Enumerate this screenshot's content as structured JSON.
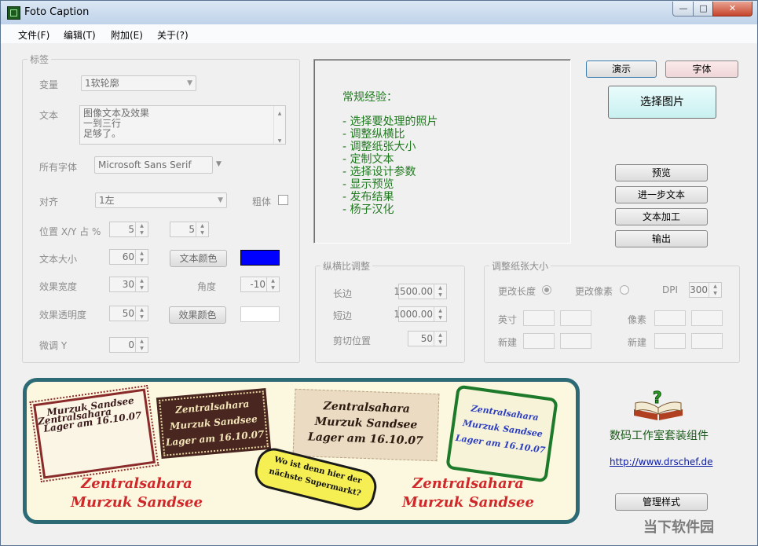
{
  "window": {
    "title": "Foto Caption"
  },
  "titlebar": {
    "min": "—",
    "max": "□",
    "close": "✕"
  },
  "menu": [
    "文件(F)",
    "编辑(T)",
    "附加(E)",
    "关于(?)"
  ],
  "label_group": {
    "title": "标签",
    "variant_label": "变量",
    "variant_value": "1软轮廓",
    "text_label": "文本",
    "text_lines": [
      "图像文本及效果",
      "一到三行",
      "足够了。"
    ],
    "font_label": "所有字体",
    "font_value": "Microsoft Sans Serif",
    "align_label": "对齐",
    "align_value": "1左",
    "bold_label": "粗体",
    "pos_label": "位置 X/Y 占 %",
    "pos_x": "5",
    "pos_y": "5",
    "size_label": "文本大小",
    "size_value": "60",
    "text_color_button": "文本颜色",
    "text_color": "#0000ff",
    "effect_width_label": "效果宽度",
    "effect_width_value": "30",
    "angle_label": "角度",
    "angle_value": "-10",
    "effect_opacity_label": "效果透明度",
    "effect_opacity_value": "50",
    "effect_color_button": "效果颜色",
    "effect_color": "#ffffff",
    "fine_y_label": "微调 Y",
    "fine_y_value": "0"
  },
  "preview": {
    "heading": "常规经验：",
    "steps": [
      "- 选择要处理的照片",
      "- 调整纵横比",
      "- 调整纸张大小",
      "- 定制文本",
      "- 选择设计参数",
      "- 显示预览",
      "- 发布结果",
      "- 杨子汉化"
    ]
  },
  "aspect_group": {
    "title": "纵横比调整",
    "long_label": "长边",
    "long_value": "1500.00",
    "short_label": "短边",
    "short_value": "1000.00",
    "crop_label": "剪切位置",
    "crop_value": "50"
  },
  "paper_group": {
    "title": "调整纸张大小",
    "change_length": "更改长度",
    "change_pixel": "更改像素",
    "dpi_label": "DPI",
    "dpi_value": "300",
    "inch_label": "英寸",
    "pixel_label": "像素",
    "new_label": "新建",
    "new_label2": "新建"
  },
  "buttons": {
    "demo": "演示",
    "font": "字体",
    "select_image": "选择图片",
    "preview": "预览",
    "more_text": "进一步文本",
    "text_process": "文本加工",
    "output": "输出",
    "manage_styles": "管理样式"
  },
  "suite": {
    "name": "数码工作室套装组件",
    "url": "http://www.drschef.de"
  },
  "banner": {
    "tag_line1": "Zentralsahara",
    "tag_line2": "Murzuk Sandsee",
    "tag_line3": "Lager am 16.10.07",
    "bubble_line1": "Wo ist denn hier der",
    "bubble_line2": "nächste Supermarkt?"
  },
  "watermark": {
    "text": "当下软件园"
  }
}
